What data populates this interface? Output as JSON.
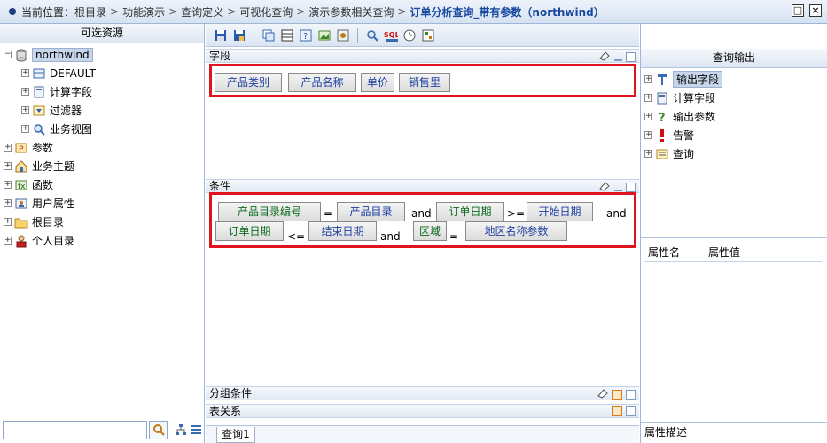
{
  "breadcrumb": {
    "prefix": "当前位置：",
    "items": [
      "根目录",
      "功能演示",
      "查询定义",
      "可视化查询",
      "演示参数相关查询"
    ],
    "current": "订单分析查询_带有参数（northwind）",
    "separator": ">"
  },
  "left_panel": {
    "title": "可选资源",
    "root": "northwind",
    "children": [
      "DEFAULT",
      "计算字段",
      "过滤器",
      "业务视图"
    ],
    "top_items": [
      "参数",
      "业务主题",
      "函数",
      "用户属性",
      "根目录",
      "个人目录"
    ],
    "search": {
      "value": "",
      "placeholder": ""
    }
  },
  "center_panel": {
    "fields_title": "字段",
    "fields": [
      "产品类别",
      "产品名称",
      "单价",
      "销售里"
    ],
    "conditions_title": "条件",
    "conditions_row1": [
      {
        "type": "chip",
        "text": "产品目录编号",
        "green": true
      },
      {
        "type": "op",
        "text": "="
      },
      {
        "type": "chip",
        "text": "产品目录"
      },
      {
        "type": "op",
        "text": "and"
      },
      {
        "type": "chip",
        "text": "订单日期",
        "green": true
      },
      {
        "type": "op",
        "text": ">="
      },
      {
        "type": "chip",
        "text": "开始日期"
      },
      {
        "type": "op",
        "text": "and"
      }
    ],
    "conditions_row2": [
      {
        "type": "chip",
        "text": "订单日期",
        "green": true
      },
      {
        "type": "op",
        "text": "<="
      },
      {
        "type": "chip",
        "text": "结束日期"
      },
      {
        "type": "op",
        "text": "and"
      },
      {
        "type": "chip",
        "text": "区域",
        "green": true
      },
      {
        "type": "op",
        "text": "="
      },
      {
        "type": "chip",
        "text": "地区名称参数"
      }
    ],
    "group_title": "分组条件",
    "relation_title": "表关系",
    "tab_label": "查询1"
  },
  "right_panel": {
    "title": "查询输出",
    "items": [
      "输出字段",
      "计算字段",
      "输出参数",
      "告警",
      "查询"
    ],
    "prop_name_header": "属性名",
    "prop_value_header": "属性值",
    "prop_desc": "属性描述"
  },
  "colors": {
    "accent": "#1a4aa0",
    "highlight_border": "#e0141f",
    "header_bg": "#dde6f2"
  },
  "icons": {
    "toolbar": [
      "save-icon",
      "save-as-icon",
      "copy-icon",
      "table-icon",
      "help-icon",
      "image-icon",
      "settings-icon",
      "zoom-icon",
      "sql-icon",
      "clock-icon",
      "grid-icon"
    ]
  }
}
